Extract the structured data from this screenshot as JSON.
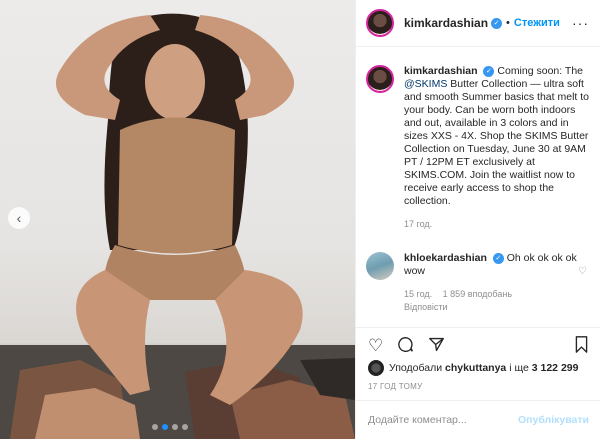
{
  "post": {
    "username": "kimkardashian",
    "follow_label": "Стежити",
    "separator": "•",
    "caption_mention": "@SKIMS",
    "caption_prefix": "Coming soon: The",
    "caption_rest": "Butter Collection — ultra soft and smooth Summer basics that melt to your body. Can be worn both indoors and out, available in 3 colors and in sizes XXS - 4X. Shop the SKIMS Butter Collection on Tuesday, June 30 at 9AM PT / 12PM ET exclusively at SKIMS.COM. Join the waitlist now to receive early access to shop the collection.",
    "caption_time": "17 год.",
    "images_count": 4,
    "active_image": 2
  },
  "comments": [
    {
      "username": "khloekardashian",
      "text": "Oh ok ok ok ok wow",
      "time": "15 год.",
      "likes": "1 859 вподобань",
      "reply_label": "Відповісти"
    }
  ],
  "likes_row": {
    "prefix": "Уподобали",
    "user": "chykuttanya",
    "connector": "і ще",
    "count": "3 122 299"
  },
  "time_ago": "17 ГОД ТОМУ",
  "comment_box": {
    "placeholder": "Додайте коментар...",
    "publish_label": "Опублікувати"
  },
  "icons": {
    "like": "heart-icon",
    "comment": "comment-icon",
    "share": "share-icon",
    "save": "bookmark-icon",
    "more": "more-icon",
    "prev": "chevron-left-icon",
    "verified": "verified-badge-icon"
  },
  "colors": {
    "accent": "#0095f6",
    "verified": "#3897f0",
    "muted": "#8e8e8e",
    "active_dot": "#1e90ff"
  }
}
